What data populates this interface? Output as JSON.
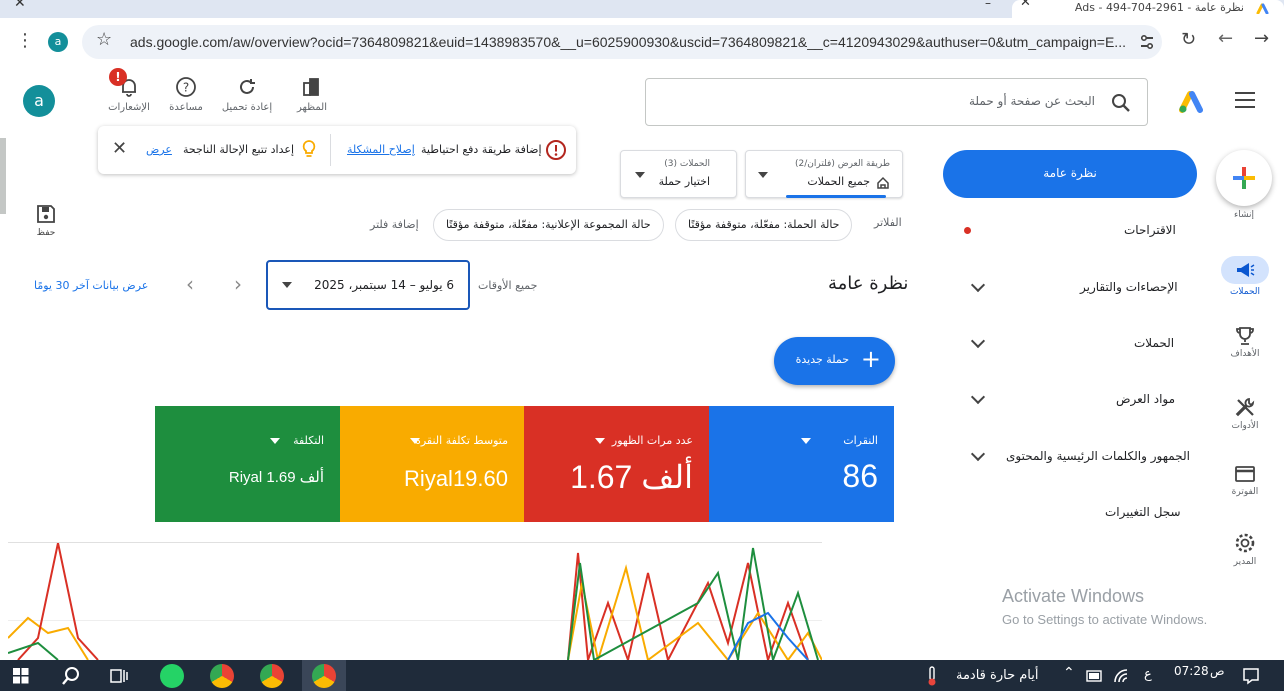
{
  "browser": {
    "tab_title": "نظرة عامة - 2961-704-494 - Ads",
    "url": "ads.google.com/aw/overview?ocid=7364809821&euid=1438983570&__u=6025900930&uscid=7364809821&__c=4120943029&authuser=0&utm_campaign=E...",
    "profile_initial": "a"
  },
  "header": {
    "search_placeholder": "البحث عن صفحة أو حملة",
    "appearance_label": "المظهر",
    "refresh_label": "إعادة تحميل",
    "help_label": "مساعدة",
    "notifications_label": "الإشعارات",
    "account_initial": "a"
  },
  "notification": {
    "message": "إضافة طريقة دفع احتياطية",
    "fix_link": "إصلاح المشكلة",
    "tip_message": "إعداد تتبع الإحالة الناجحة",
    "view_link": "عرض"
  },
  "rail": {
    "create_label": "إنشاء",
    "campaigns_label": "الحملات",
    "goals_label": "الأهداف",
    "tools_label": "الأدوات",
    "billing_label": "الفوترة",
    "admin_label": "المدير"
  },
  "nav": {
    "overview": "نظرة عامة",
    "recommendations": "الاقتراحات",
    "insights_reports": "الإحصاءات والتقارير",
    "campaigns": "الحملات",
    "assets": "مواد العرض",
    "audiences": "الجمهور والكلمات الرئيسية والمحتوى",
    "change_history": "سجل التغييرات"
  },
  "selectors": {
    "view_label": "طريقة العرض (فلتران/2)",
    "view_value": "جميع الحملات",
    "campaigns_label": "الحملات (3)",
    "campaigns_value": "اختيار حملة"
  },
  "filters": {
    "label": "الفلاتر",
    "chip1": "حالة الحملة: مفعّلة، متوقفة مؤقتًا",
    "chip2": "حالة المجموعة الإعلانية: مفعّلة، متوقفة مؤقتًا",
    "add": "إضافة فلتر",
    "save_label": "حفظ"
  },
  "page": {
    "title": "نظرة عامة",
    "all_time": "جميع الأوقات",
    "date_range": "6 يوليو – 14 سبتمبر، 2025",
    "last30": "عرض بيانات آخر 30 يومًا",
    "new_campaign": "حملة جديدة"
  },
  "metrics": [
    {
      "label": "النقرات",
      "value": "86",
      "color": "#1a73e8"
    },
    {
      "label": "عدد مرات الظهور",
      "value": "1.67 ألف",
      "color": "#d93025"
    },
    {
      "label": "متوسط تكلفة النقرة",
      "value": "Riyal19.60",
      "color": "#f9ab00"
    },
    {
      "label": "التكلفة",
      "value": "Riyal 1.69 ألف",
      "color": "#1e8e3e"
    }
  ],
  "windows": {
    "activate_title": "Activate Windows",
    "activate_sub": "Go to Settings to activate Windows."
  },
  "taskbar": {
    "time": "07:28",
    "ampm": "ص",
    "weather": "أيام حارة قادمة",
    "lang": "ع"
  }
}
